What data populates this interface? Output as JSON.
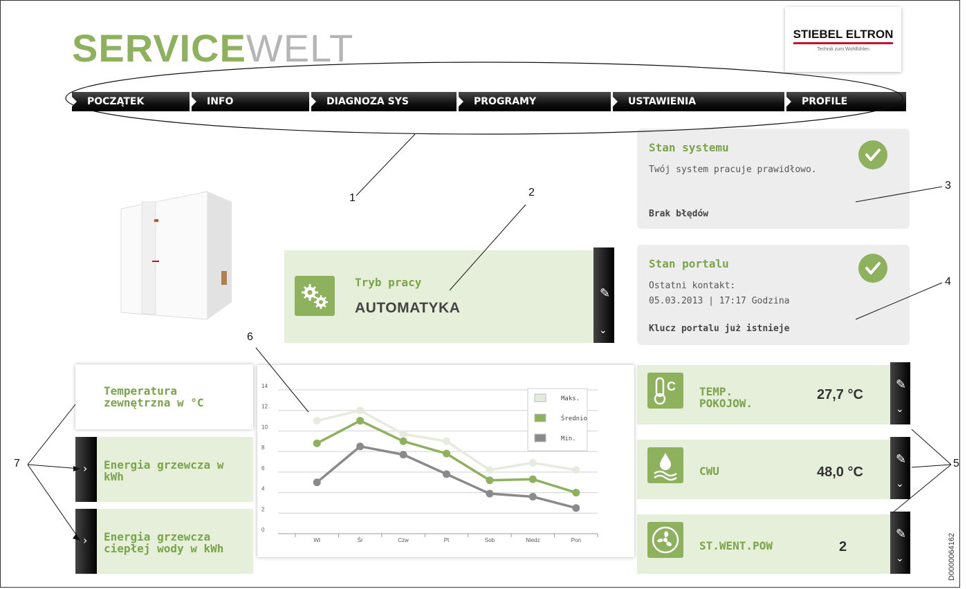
{
  "brand": {
    "logo_green": "SERVICE",
    "logo_gray": "WELT",
    "company": "STIEBEL ELTRON",
    "tagline": "Technik zum Wohlfühlen"
  },
  "nav": [
    "POCZĄTEK",
    "INFO",
    "DIAGNOZA SYS",
    "PROGRAMY",
    "USTAWIENIA",
    "PROFILE"
  ],
  "system_status": {
    "title": "Stan systemu",
    "text": "Twój system pracuje prawidłowo.",
    "footer": "Brak błędów"
  },
  "portal_status": {
    "title": "Stan portalu",
    "line1": "Ostatni kontakt:",
    "line2": "05.03.2013 | 17:17 Godzina",
    "footer": "Klucz portalu już istnieje"
  },
  "mode": {
    "label": "Tryb pracy",
    "value": "AUTOMATYKA"
  },
  "sensors": [
    {
      "label1": "TEMP.",
      "label2": "POKOJOW.",
      "value": "27,7 °C",
      "icon": "thermometer-icon"
    },
    {
      "label1": "CWU",
      "label2": "",
      "value": "48,0 °C",
      "icon": "water-drop-icon"
    },
    {
      "label1": "ST.WENT.POW",
      "label2": "",
      "value": "2",
      "icon": "fan-icon"
    }
  ],
  "left_menu": [
    {
      "line1": "Temperatura",
      "line2": "zewnętrzna w °C"
    },
    {
      "line1": "Energia grzewcza w",
      "line2": "kWh"
    },
    {
      "line1": "Energia grzewcza",
      "line2": "ciepłej wody w kWh"
    }
  ],
  "callouts": [
    "1",
    "2",
    "3",
    "4",
    "5",
    "6",
    "7"
  ],
  "doc_id": "D0000064162",
  "colors": {
    "accent": "#8db15d",
    "panel_green": "#e5efd9",
    "panel_gray": "#ededed"
  },
  "chart_data": {
    "type": "line",
    "categories": [
      "Wt",
      "Śr",
      "Czw",
      "Pt",
      "Sob",
      "Niedz",
      "Pon"
    ],
    "ylim": [
      0,
      14
    ],
    "yticks": [
      0,
      2,
      4,
      6,
      8,
      10,
      12,
      14
    ],
    "legend_position": "top-right",
    "series": [
      {
        "name": "Maks.",
        "color": "#e6ebdf",
        "values": [
          11,
          12,
          9.7,
          9,
          6.2,
          6.9,
          6.2
        ]
      },
      {
        "name": "Średnio",
        "color": "#8db15d",
        "values": [
          8.8,
          11,
          9,
          7.8,
          5.2,
          5.3,
          4
        ]
      },
      {
        "name": "Min.",
        "color": "#8a8a8a",
        "values": [
          5,
          8.5,
          7.7,
          5.8,
          3.9,
          3.6,
          2.5
        ]
      }
    ]
  }
}
